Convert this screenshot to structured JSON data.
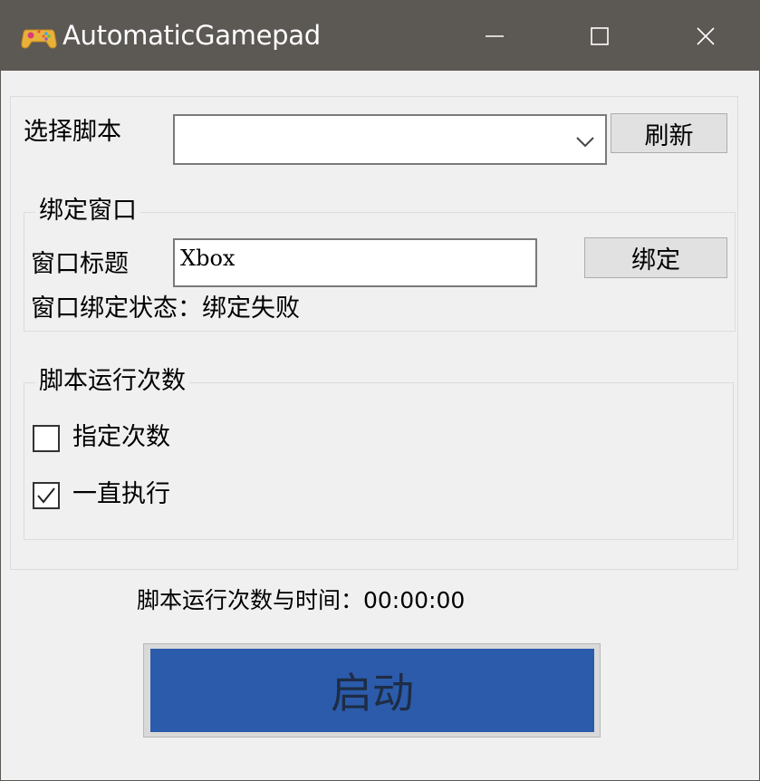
{
  "window": {
    "title": "AutomaticGamepad",
    "app_icon": "gamepad-icon",
    "controls": [
      "minimize-icon",
      "maximize-icon",
      "close-icon"
    ]
  },
  "script_select": {
    "label": "选择脚本",
    "value": "",
    "refresh_label": "刷新"
  },
  "bind_window": {
    "group_title": "绑定窗口",
    "title_label": "窗口标题",
    "title_value": "Xbox",
    "bind_label": "绑定",
    "status_text": "窗口绑定状态：绑定失败"
  },
  "run_count": {
    "group_title": "脚本运行次数",
    "options": [
      {
        "label": "指定次数",
        "checked": false
      },
      {
        "label": "一直执行",
        "checked": true
      }
    ]
  },
  "status": {
    "count_time_text": "脚本运行次数与时间：00:00:00"
  },
  "start_button": {
    "label": "启动"
  },
  "colors": {
    "titlebar": "#5c5854",
    "start_button": "#2b5baa",
    "window_bg": "#f0f0f0"
  }
}
